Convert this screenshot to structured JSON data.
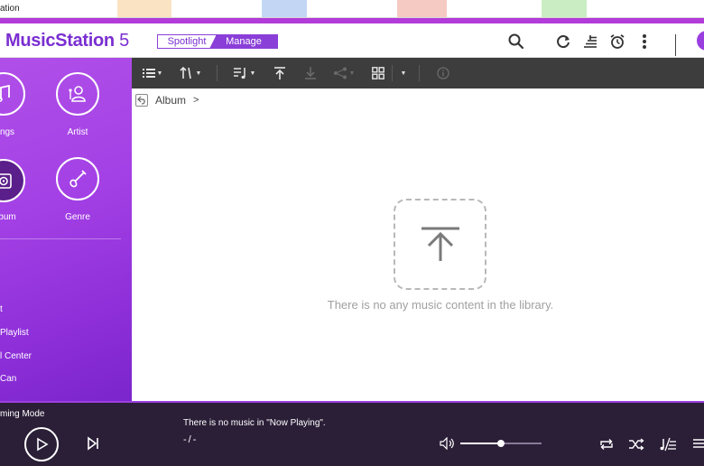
{
  "browser": {
    "tab_title": "ation"
  },
  "header": {
    "app_name_bold": "MusicStation",
    "app_name_version": " 5",
    "mode_spotlight": "Spotlight",
    "mode_manage": "Manage",
    "icons": [
      "search-icon",
      "refresh-icon",
      "queue-icon",
      "alarm-icon",
      "more-icon"
    ]
  },
  "sidebar": {
    "categories": [
      {
        "label": "ngs",
        "icon": "music-note-icon",
        "selected": false
      },
      {
        "label": "Artist",
        "icon": "artist-icon",
        "selected": false
      },
      {
        "label": "bum",
        "icon": "album-disc-icon",
        "selected": true
      },
      {
        "label": "Genre",
        "icon": "guitar-icon",
        "selected": false
      }
    ],
    "links": [
      "t",
      "Playlist",
      "l Center",
      "Can"
    ]
  },
  "toolbar": {
    "icons": [
      "list-view-icon",
      "sort-icon",
      "add-to-playlist-icon",
      "upload-icon",
      "download-icon",
      "share-icon",
      "grid-view-icon",
      "more-caret-icon",
      "info-icon"
    ]
  },
  "breadcrumb": {
    "current": "Album",
    "separator": ">"
  },
  "main": {
    "empty_message": "There is no any music content in the library."
  },
  "player": {
    "mode_label": "ming Mode",
    "now_playing_message": "There is no music in \"Now Playing\".",
    "time": "-/-",
    "volume_percent": 50
  },
  "colors": {
    "accent": "#b23bd9",
    "sidebar": "#a441e6",
    "toolbar": "#3d3d3d",
    "player": "#2b1f38"
  }
}
